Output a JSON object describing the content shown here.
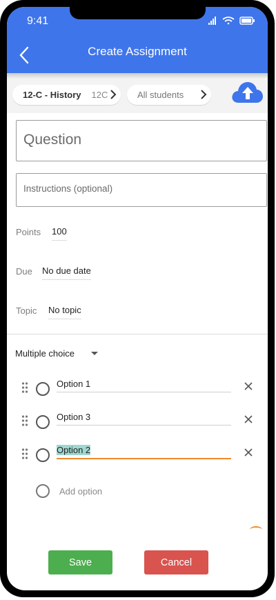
{
  "status": {
    "time": "9:41"
  },
  "header": {
    "title": "Create Assignment"
  },
  "chips": {
    "class_label": "12-C - History",
    "class_short": "12C",
    "students": "All students"
  },
  "form": {
    "question_placeholder": "Question",
    "instructions_placeholder": "Instructions (optional)",
    "points_label": "Points",
    "points_value": "100",
    "due_label": "Due",
    "due_value": "No due date",
    "topic_label": "Topic",
    "topic_value": "No topic",
    "type_label": "Multiple choice"
  },
  "options": [
    {
      "label": "Option 1"
    },
    {
      "label": "Option 3"
    },
    {
      "label": "Option 2"
    }
  ],
  "add_option_label": "Add option",
  "actions": {
    "save": "Save",
    "cancel": "Cancel"
  },
  "colors": {
    "header": "#3f75ea",
    "save": "#4cae4f",
    "cancel": "#d9534f",
    "focus": "#f08a2a"
  }
}
